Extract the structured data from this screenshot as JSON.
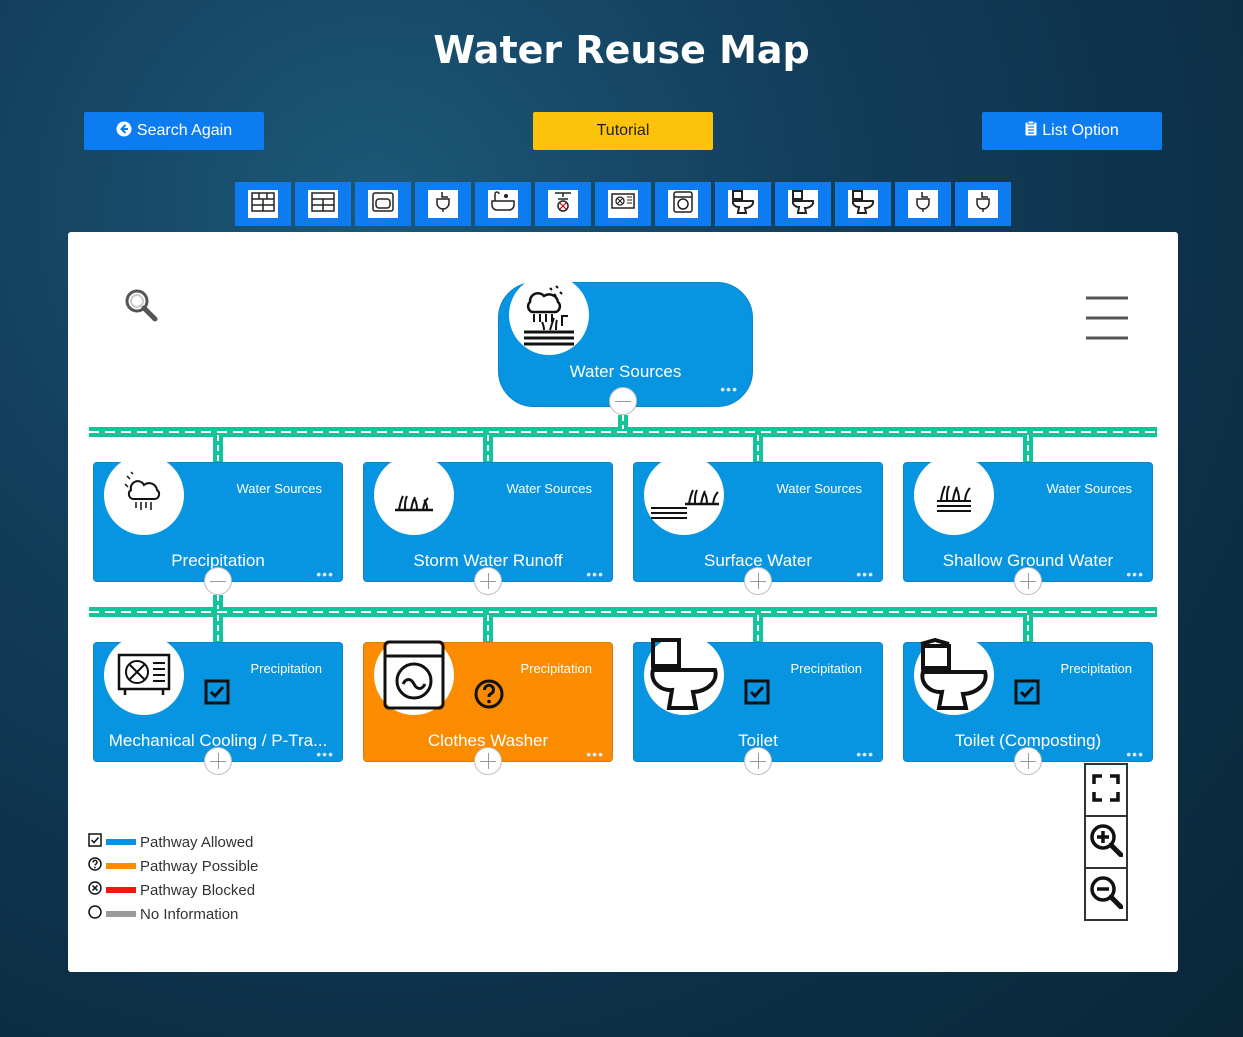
{
  "page": {
    "title": "Water Reuse Map"
  },
  "toolbar": {
    "search_again": "Search Again",
    "tutorial": "Tutorial",
    "list_option": "List Option"
  },
  "fixture_icons": [
    "kitchen-cabinets-icon",
    "kitchen-cabinets-icon",
    "dishwasher-icon",
    "sink-icon",
    "bathtub-icon",
    "shower-icon",
    "mechanical-cooling-icon",
    "clothes-washer-icon",
    "toilet-icon",
    "toilet-icon",
    "toilet-icon",
    "sink-icon",
    "sink-icon"
  ],
  "root": {
    "label": "Water Sources",
    "icon": "water-sources-icon"
  },
  "level1": [
    {
      "category": "Water Sources",
      "label": "Precipitation",
      "icon": "rain-cloud-icon",
      "toggle": "minus"
    },
    {
      "category": "Water Sources",
      "label": "Storm Water Runoff",
      "icon": "grass-icon",
      "toggle": "plus"
    },
    {
      "category": "Water Sources",
      "label": "Surface Water",
      "icon": "grass-water-icon",
      "toggle": "plus"
    },
    {
      "category": "Water Sources",
      "label": "Shallow Ground Water",
      "icon": "ground-water-icon",
      "toggle": "plus"
    }
  ],
  "level2": [
    {
      "category": "Precipitation",
      "label": "Mechanical Cooling / P-Tra...",
      "icon": "mechanical-cooling-icon",
      "status": "allowed",
      "color": "#0795e1"
    },
    {
      "category": "Precipitation",
      "label": "Clothes Washer",
      "icon": "clothes-washer-icon",
      "status": "possible",
      "color": "#fb8c00"
    },
    {
      "category": "Precipitation",
      "label": "Toilet",
      "icon": "toilet-icon",
      "status": "allowed",
      "color": "#0795e1"
    },
    {
      "category": "Precipitation",
      "label": "Toilet (Composting)",
      "icon": "toilet-icon",
      "status": "allowed",
      "color": "#0795e1"
    }
  ],
  "legend": [
    {
      "label": "Pathway Allowed",
      "color": "#0d8fe5",
      "icon": "checkbox-icon"
    },
    {
      "label": "Pathway Possible",
      "color": "#fb8c00",
      "icon": "question-icon"
    },
    {
      "label": "Pathway Blocked",
      "color": "#f2160c",
      "icon": "x-circle-icon"
    },
    {
      "label": "No Information",
      "color": "#9a9a9a",
      "icon": "empty-circle-icon"
    }
  ],
  "node_dots": "•••",
  "colors": {
    "accent": "#0d7cf0",
    "node": "#0795e1",
    "connector": "#11c49a",
    "tutorial": "#fcc30a"
  }
}
